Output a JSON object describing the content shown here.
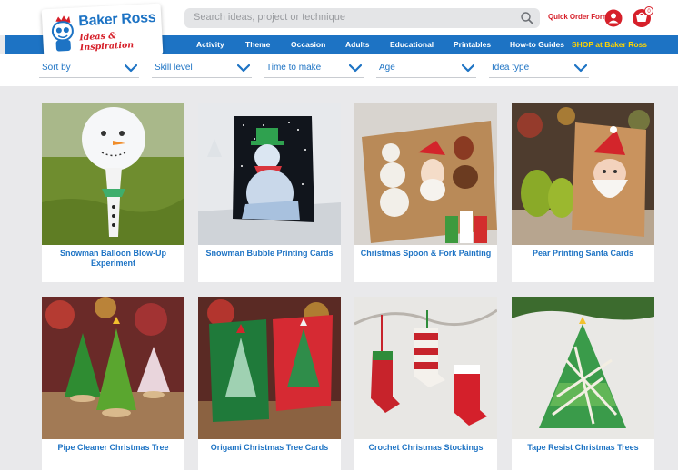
{
  "header": {
    "search_placeholder": "Search ideas, project or technique",
    "quick_order": "Quick Order Form",
    "basket_count": "0"
  },
  "logo": {
    "brand": "Baker Ross",
    "tagline": "Ideas & Inspiration"
  },
  "nav": {
    "items": [
      {
        "label": "Activity"
      },
      {
        "label": "Theme"
      },
      {
        "label": "Occasion"
      },
      {
        "label": "Adults"
      },
      {
        "label": "Educational"
      },
      {
        "label": "Printables"
      },
      {
        "label": "How-to Guides"
      },
      {
        "label": "SHOP at Baker Ross"
      }
    ],
    "shop_color": "#ffd400"
  },
  "filters": [
    {
      "label": "Sort by"
    },
    {
      "label": "Skill level"
    },
    {
      "label": "Time to make"
    },
    {
      "label": "Age"
    },
    {
      "label": "Idea type"
    }
  ],
  "cards": [
    {
      "title": "Snowman Balloon Blow-Up Experiment",
      "image": "snowman-balloon-photo"
    },
    {
      "title": "Snowman Bubble Printing Cards",
      "image": "snowman-card-photo"
    },
    {
      "title": "Christmas Spoon & Fork Painting",
      "image": "spoon-fork-painting-photo"
    },
    {
      "title": "Pear Printing Santa Cards",
      "image": "pear-santa-card-photo"
    },
    {
      "title": "Pipe Cleaner Christmas Tree",
      "image": "pipe-cleaner-tree-photo"
    },
    {
      "title": "Origami Christmas Tree Cards",
      "image": "origami-tree-card-photo"
    },
    {
      "title": "Crochet Christmas Stockings",
      "image": "crochet-stockings-photo"
    },
    {
      "title": "Tape Resist Christmas Trees",
      "image": "tape-resist-tree-photo"
    }
  ],
  "colors": {
    "brand_blue": "#1d73c4",
    "brand_red": "#d6202a",
    "page_bg": "#e9e9eb"
  }
}
